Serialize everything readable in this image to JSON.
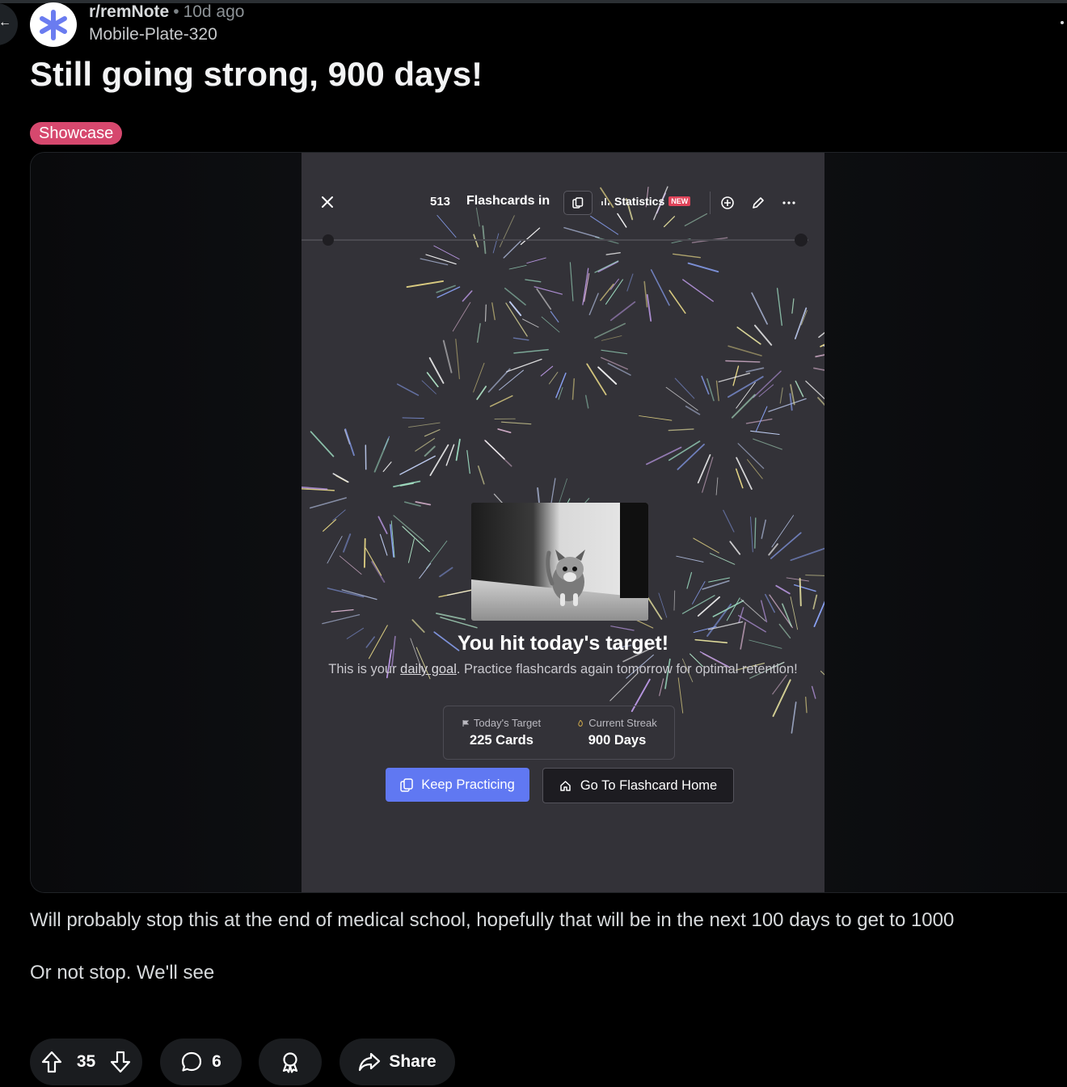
{
  "post": {
    "subreddit": "r/remNote",
    "age": "10d ago",
    "author": "Mobile-Plate-320",
    "title": "Still going strong, 900 days!",
    "flair": "Showcase",
    "body": [
      "Will probably stop this at the end of medical school, hopefully that will be in the next 100 days to get to 1000",
      "Or not stop. We'll see"
    ]
  },
  "screenshot": {
    "toolbar": {
      "count": "513",
      "title": "Flashcards in",
      "statistics_label": "Statistics",
      "new_badge": "NEW"
    },
    "completion": {
      "title": "You hit today's target!",
      "desc_before": "This is your ",
      "desc_link": "daily goal",
      "desc_after": ". Practice flashcards again tomorrow for optimal retention!",
      "target_label": "Today's Target",
      "target_value": "225 Cards",
      "streak_label": "Current Streak",
      "streak_value": "900 Days",
      "keep_button": "Keep Practicing",
      "home_button": "Go To Flashcard Home"
    }
  },
  "actions": {
    "score": "35",
    "comments": "6",
    "share_label": "Share"
  },
  "colors": {
    "flair": "#d6486e",
    "keep_button": "#6078f2",
    "avatar_logo": "#6a7cf0",
    "new_badge": "#e0445a"
  },
  "icons": [
    "back-icon",
    "more-icon",
    "close-icon",
    "deck-icon",
    "bar-chart-icon",
    "add-icon",
    "edit-icon",
    "ellipsis-icon",
    "flag-icon",
    "flame-icon",
    "cards-icon",
    "home-icon",
    "upvote-icon",
    "downvote-icon",
    "comment-icon",
    "award-icon",
    "share-icon"
  ]
}
